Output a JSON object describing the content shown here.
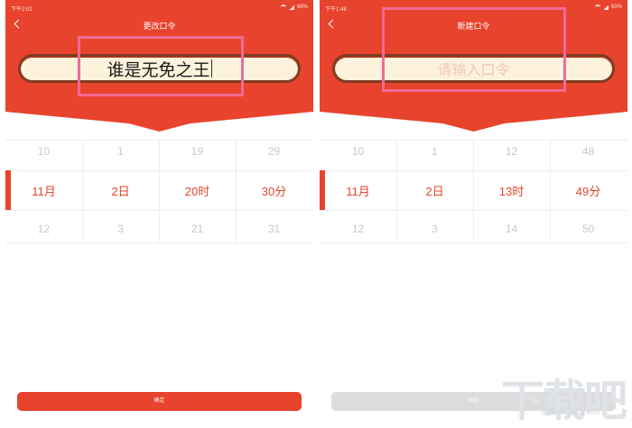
{
  "left": {
    "status_time": "下午2:02",
    "battery": "68%",
    "title": "更改口令",
    "input_value": "谁是无免之王",
    "picker": [
      {
        "above": "10",
        "selected": "11月",
        "below": "12"
      },
      {
        "above": "1",
        "selected": "2日",
        "below": "3"
      },
      {
        "above": "19",
        "selected": "20时",
        "below": "21"
      },
      {
        "above": "29",
        "selected": "30分",
        "below": "31"
      }
    ],
    "confirm_label": "确定"
  },
  "right": {
    "status_time": "下午1:48",
    "battery": "60%",
    "title": "新建口令",
    "input_placeholder": "请输入口令",
    "picker": [
      {
        "above": "10",
        "selected": "11月",
        "below": "12"
      },
      {
        "above": "1",
        "selected": "2日",
        "below": "3"
      },
      {
        "above": "12",
        "selected": "13时",
        "below": "14"
      },
      {
        "above": "48",
        "selected": "49分",
        "below": "50"
      }
    ],
    "confirm_label": "确定"
  },
  "watermark": {
    "logo": "下载吧",
    "url": "www.xiazaiba.com"
  },
  "colors": {
    "primary_red": "#e8432d",
    "input_bg": "#fdf2dc",
    "input_border": "#7e3d22",
    "highlight_box": "#f26b94",
    "disabled_button": "#dcdcdc"
  }
}
